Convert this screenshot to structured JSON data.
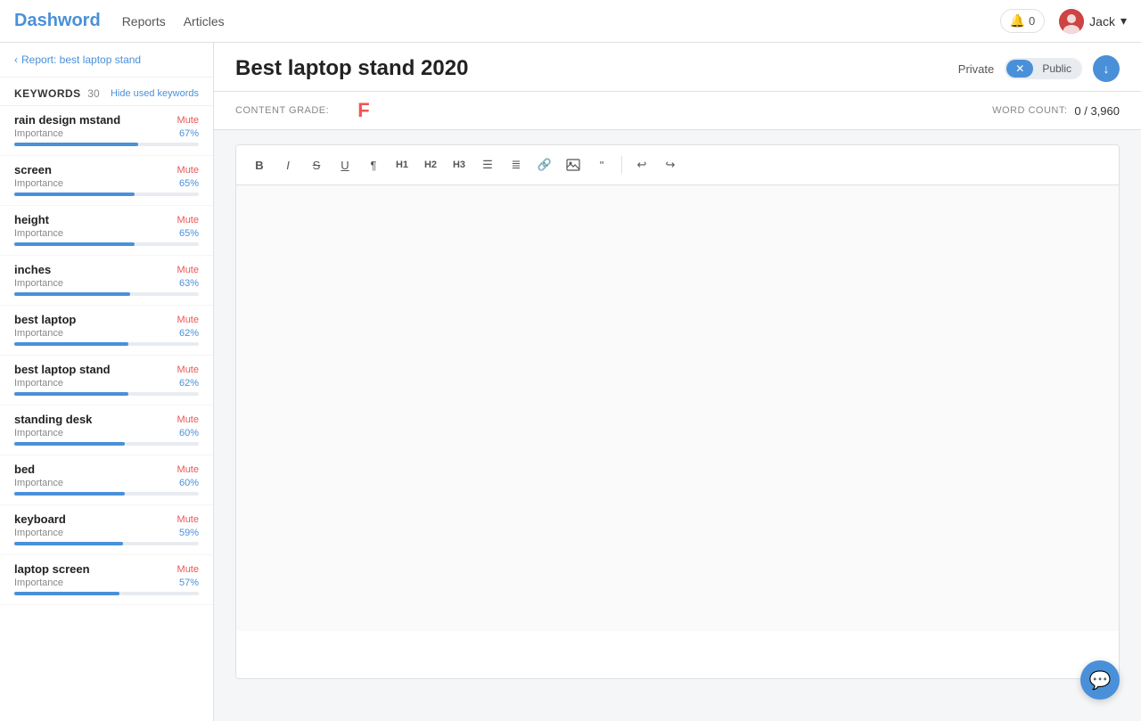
{
  "app": {
    "logo": "Dashword",
    "nav": [
      {
        "label": "Reports",
        "active": true
      },
      {
        "label": "Articles",
        "active": false
      }
    ]
  },
  "topright": {
    "notifications_count": "0",
    "user_name": "Jack"
  },
  "sidebar": {
    "back_label": "Report: best laptop stand",
    "keywords_title": "KEYWORDS",
    "keywords_count": "30",
    "hide_label": "Hide used keywords",
    "items": [
      {
        "name": "rain design mstand",
        "importance_label": "Importance",
        "importance_pct": 67,
        "pct_label": "67%"
      },
      {
        "name": "screen",
        "importance_label": "Importance",
        "importance_pct": 65,
        "pct_label": "65%"
      },
      {
        "name": "height",
        "importance_label": "Importance",
        "importance_pct": 65,
        "pct_label": "65%"
      },
      {
        "name": "inches",
        "importance_label": "Importance",
        "importance_pct": 63,
        "pct_label": "63%"
      },
      {
        "name": "best laptop",
        "importance_label": "Importance",
        "importance_pct": 62,
        "pct_label": "62%"
      },
      {
        "name": "best laptop stand",
        "importance_label": "Importance",
        "importance_pct": 62,
        "pct_label": "62%"
      },
      {
        "name": "standing desk",
        "importance_label": "Importance",
        "importance_pct": 60,
        "pct_label": "60%"
      },
      {
        "name": "bed",
        "importance_label": "Importance",
        "importance_pct": 60,
        "pct_label": "60%"
      },
      {
        "name": "keyboard",
        "importance_label": "Importance",
        "importance_pct": 59,
        "pct_label": "59%"
      },
      {
        "name": "laptop screen",
        "importance_label": "Importance",
        "importance_pct": 57,
        "pct_label": "57%"
      }
    ],
    "mute_label": "Mute"
  },
  "main": {
    "article_title": "Best laptop stand 2020",
    "privacy": {
      "private_label": "Private",
      "public_label": "Public"
    },
    "content_grade_label": "CONTENT GRADE:",
    "content_grade_value": "F",
    "word_count_label": "WORD COUNT:",
    "word_count_value": "0 / 3,960",
    "toolbar": {
      "buttons": [
        "B",
        "I",
        "S",
        "U",
        "¶",
        "H1",
        "H2",
        "H3",
        "≡",
        "≣",
        "🔗",
        "🖼",
        "❝",
        "—",
        "↩",
        "↪"
      ]
    },
    "editor_placeholder": ""
  }
}
